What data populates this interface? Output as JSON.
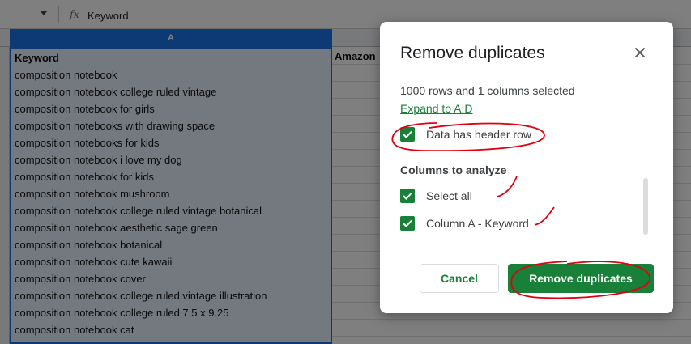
{
  "formula_bar": {
    "fx_label": "fx",
    "content": "Keyword"
  },
  "sheet": {
    "column_a_header": "A",
    "header_cell": "Keyword",
    "column_b_header_cell": "Amazon",
    "rows": [
      "composition notebook",
      "composition notebook college ruled vintage",
      "composition notebook for girls",
      "composition notebooks with drawing space",
      "composition notebooks for kids",
      "composition notebook i love my dog",
      "composition notebook for kids",
      "composition notebook mushroom",
      "composition notebook college ruled vintage botanical",
      "composition notebook aesthetic sage green",
      "composition notebook botanical",
      "composition notebook cute kawaii",
      "composition notebook cover",
      "composition notebook college ruled vintage illustration",
      "composition notebook college ruled 7.5 x 9.25",
      "composition notebook cat"
    ]
  },
  "dialog": {
    "title": "Remove duplicates",
    "close_icon": "close-icon",
    "summary": "1000 rows and 1 columns selected",
    "expand_link": "Expand to A:D",
    "header_row_label": "Data has header row",
    "columns_heading": "Columns to analyze",
    "select_all_label": "Select all",
    "column_a_label": "Column A - Keyword",
    "cancel_label": "Cancel",
    "submit_label": "Remove duplicates"
  },
  "colors": {
    "accent_green": "#188038",
    "selection_blue": "#1a73e8",
    "annotation_red": "#e0000f"
  }
}
